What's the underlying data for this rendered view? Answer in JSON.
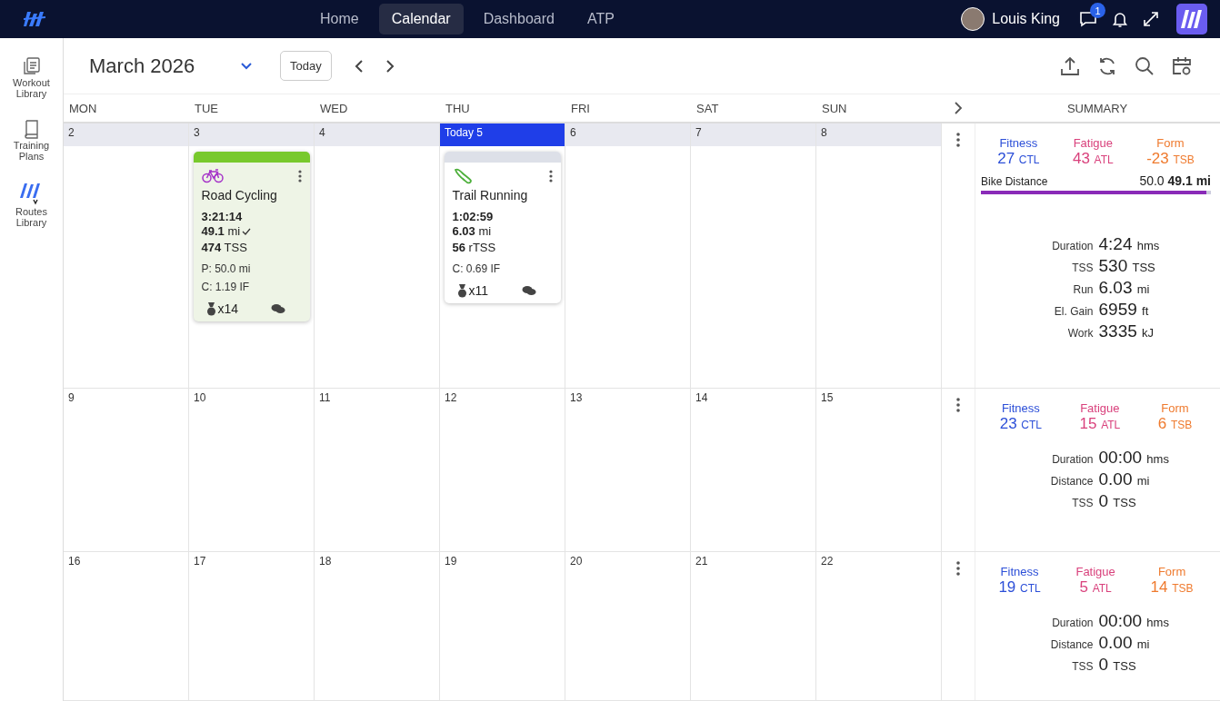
{
  "nav": {
    "items": [
      {
        "label": "Home",
        "selected": false
      },
      {
        "label": "Calendar",
        "selected": true
      },
      {
        "label": "Dashboard",
        "selected": false
      },
      {
        "label": "ATP",
        "selected": false
      }
    ],
    "user": "Louis King",
    "notification_count": "1"
  },
  "sidebar": {
    "items": [
      {
        "kind": "workouts",
        "label": "Workout Library"
      },
      {
        "kind": "plans",
        "label": "Training Plans"
      },
      {
        "kind": "routes",
        "label": "Routes Library"
      }
    ]
  },
  "toolbar": {
    "title": "March 2026",
    "today_button": "Today"
  },
  "calendar": {
    "day_headers": [
      "MON",
      "TUE",
      "WED",
      "THU",
      "FRI",
      "SAT",
      "SUN"
    ],
    "summary_header": "SUMMARY",
    "weeks": [
      {
        "days": [
          {
            "date": "2",
            "today": false
          },
          {
            "date": "3",
            "today": false,
            "workouts": [
              {
                "kind": "bike",
                "completed": true,
                "title": "Road Cycling",
                "duration": "3:21:14",
                "distance": "49.1",
                "distance_unit": "mi",
                "tss": "474",
                "tss_unit": "TSS",
                "details": [
                  "P: 50.0 mi",
                  "C: 1.19 IF"
                ],
                "medals": "x14"
              }
            ]
          },
          {
            "date": "4",
            "today": false
          },
          {
            "date": "Today 5",
            "today": true,
            "workouts": [
              {
                "kind": "run",
                "completed": false,
                "title": "Trail Running",
                "duration": "1:02:59",
                "distance": "6.03",
                "distance_unit": "mi",
                "tss": "56",
                "tss_unit": "rTSS",
                "details": [
                  "C: 0.69 IF"
                ],
                "medals": "x11"
              }
            ]
          },
          {
            "date": "6",
            "today": false
          },
          {
            "date": "7",
            "today": false
          },
          {
            "date": "8",
            "today": false
          }
        ],
        "summary": {
          "metrics": [
            {
              "kind": "fitness",
              "label": "Fitness",
              "value": "27",
              "unit": "CTL"
            },
            {
              "kind": "fatigue",
              "label": "Fatigue",
              "value": "43",
              "unit": "ATL"
            },
            {
              "kind": "form",
              "label": "Form",
              "value": "-23",
              "unit": "TSB"
            }
          ],
          "goal": {
            "label": "Bike Distance",
            "planned": "50.0",
            "actual": "49.1 mi",
            "level": 0.98
          },
          "stats": [
            {
              "label": "Duration",
              "value": "4:24",
              "unit": "hms"
            },
            {
              "label": "TSS",
              "value": "530",
              "unit": "TSS"
            },
            {
              "label": "Run",
              "value": "6.03",
              "unit": "mi"
            },
            {
              "label": "El. Gain",
              "value": "6959",
              "unit": "ft"
            },
            {
              "label": "Work",
              "value": "3335",
              "unit": "kJ"
            }
          ]
        }
      },
      {
        "days": [
          {
            "date": "9",
            "today": false
          },
          {
            "date": "10",
            "today": false
          },
          {
            "date": "11",
            "today": false
          },
          {
            "date": "12",
            "today": false
          },
          {
            "date": "13",
            "today": false
          },
          {
            "date": "14",
            "today": false
          },
          {
            "date": "15",
            "today": false
          }
        ],
        "summary": {
          "metrics": [
            {
              "kind": "fitness",
              "label": "Fitness",
              "value": "23",
              "unit": "CTL"
            },
            {
              "kind": "fatigue",
              "label": "Fatigue",
              "value": "15",
              "unit": "ATL"
            },
            {
              "kind": "form",
              "label": "Form",
              "value": "6",
              "unit": "TSB"
            }
          ],
          "stats": [
            {
              "label": "Duration",
              "value": "00:00",
              "unit": "hms"
            },
            {
              "label": "Distance",
              "value": "0.00",
              "unit": "mi"
            },
            {
              "label": "TSS",
              "value": "0",
              "unit": "TSS"
            }
          ]
        }
      },
      {
        "days": [
          {
            "date": "16",
            "today": false
          },
          {
            "date": "17",
            "today": false
          },
          {
            "date": "18",
            "today": false
          },
          {
            "date": "19",
            "today": false
          },
          {
            "date": "20",
            "today": false
          },
          {
            "date": "21",
            "today": false
          },
          {
            "date": "22",
            "today": false
          }
        ],
        "summary": {
          "metrics": [
            {
              "kind": "fitness",
              "label": "Fitness",
              "value": "19",
              "unit": "CTL"
            },
            {
              "kind": "fatigue",
              "label": "Fatigue",
              "value": "5",
              "unit": "ATL"
            },
            {
              "kind": "form",
              "label": "Form",
              "value": "14",
              "unit": "TSB"
            }
          ],
          "stats": [
            {
              "label": "Duration",
              "value": "00:00",
              "unit": "hms"
            },
            {
              "label": "Distance",
              "value": "0.00",
              "unit": "mi"
            },
            {
              "label": "TSS",
              "value": "0",
              "unit": "TSS"
            }
          ]
        }
      }
    ]
  }
}
